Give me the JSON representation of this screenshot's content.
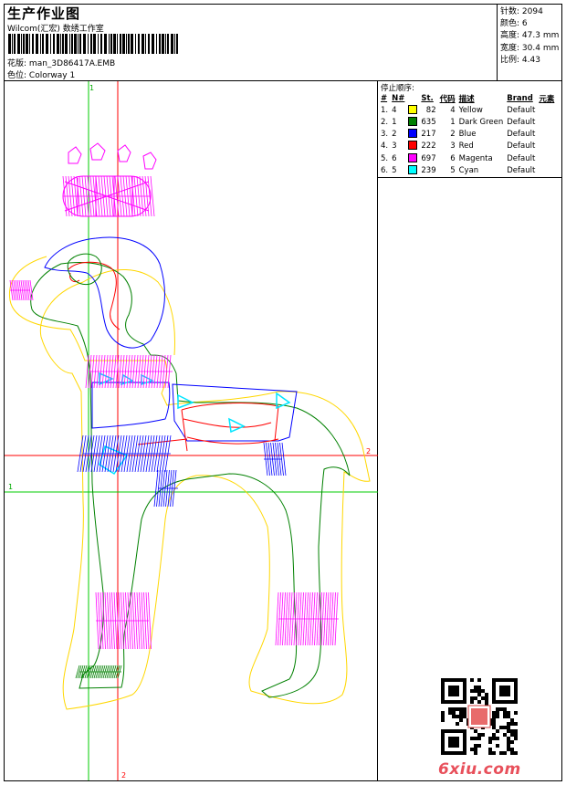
{
  "header": {
    "title": "生产作业图",
    "subtitle": "Wilcom(汇宏) 数绣工作室",
    "design_label": "花版:",
    "design_file": "man_3D86417A.EMB",
    "colorway_label": "色位:",
    "colorway": "Colorway 1"
  },
  "stats": {
    "stitches_label": "针数:",
    "stitches": "2094",
    "colors_label": "颜色:",
    "colors": "6",
    "height_label": "高度:",
    "height": "47.3 mm",
    "width_label": "宽度:",
    "width": "30.4 mm",
    "scale_label": "比例:",
    "scale": "4.43"
  },
  "stop_sequence": {
    "title": "停止顺序:",
    "columns": [
      "#",
      "N#",
      "St.",
      "代码",
      "描述",
      "Brand",
      "元素"
    ],
    "rows": [
      {
        "idx": "1.",
        "stop": "4",
        "color": "#ffff00",
        "stitches": "82",
        "code": "4",
        "desc": "Yellow",
        "brand": "Default"
      },
      {
        "idx": "2.",
        "stop": "1",
        "color": "#008000",
        "stitches": "635",
        "code": "1",
        "desc": "Dark Green",
        "brand": "Default"
      },
      {
        "idx": "3.",
        "stop": "2",
        "color": "#0000ff",
        "stitches": "217",
        "code": "2",
        "desc": "Blue",
        "brand": "Default"
      },
      {
        "idx": "4.",
        "stop": "3",
        "color": "#ff0000",
        "stitches": "222",
        "code": "3",
        "desc": "Red",
        "brand": "Default"
      },
      {
        "idx": "5.",
        "stop": "6",
        "color": "#ff00ff",
        "stitches": "697",
        "code": "6",
        "desc": "Magenta",
        "brand": "Default"
      },
      {
        "idx": "6.",
        "stop": "5",
        "color": "#00ffff",
        "stitches": "239",
        "code": "5",
        "desc": "Cyan",
        "brand": "Default"
      }
    ]
  },
  "axes": {
    "top_green": "1",
    "left_green": "1",
    "right_red": "2",
    "bottom_red": "2"
  },
  "watermark": "6xiu.com"
}
